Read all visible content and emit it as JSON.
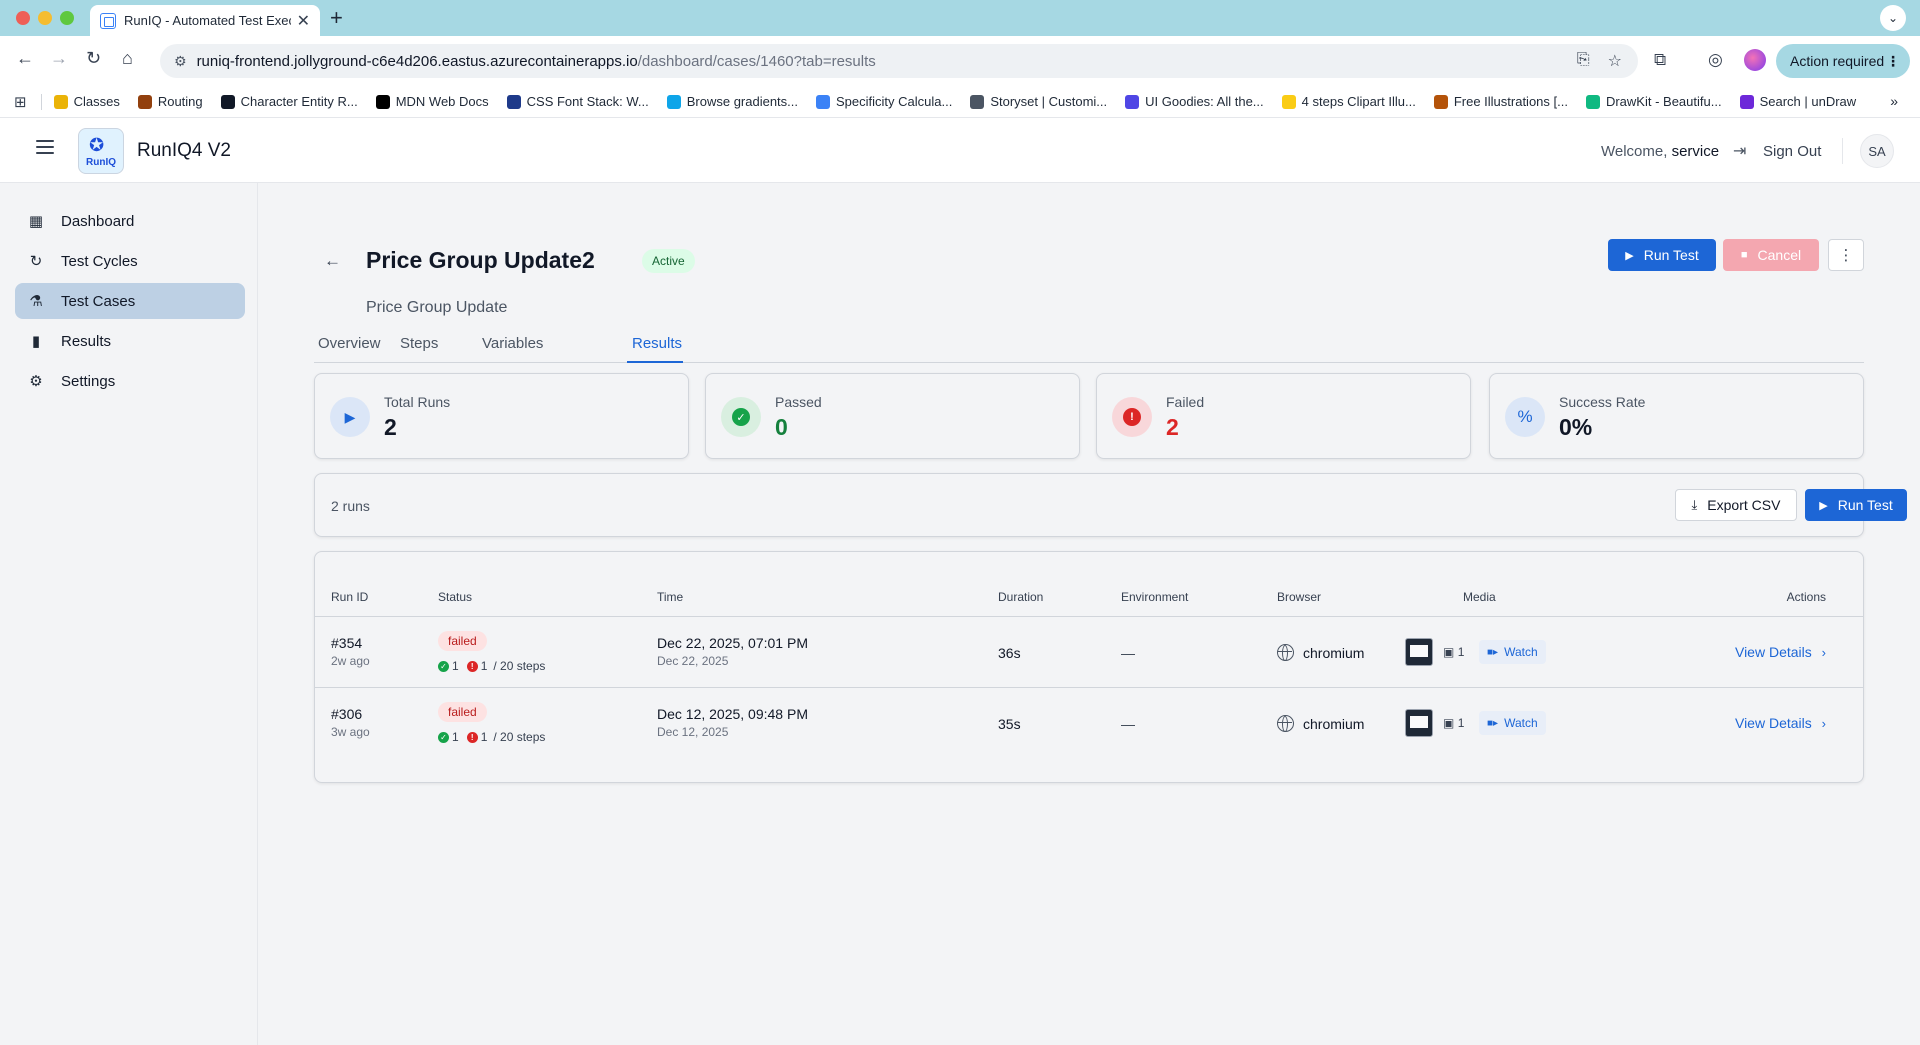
{
  "browser": {
    "tab_title": "RunIQ - Automated Test Exec",
    "url_host": "runiq-frontend.jollyground-c6e4d206.eastus.azurecontainerapps.io",
    "url_path": "/dashboard/cases/1460?tab=results",
    "action_required": "Action required",
    "bookmarks": [
      {
        "label": "Classes",
        "color": "#eab308"
      },
      {
        "label": "Routing",
        "color": "#92400e"
      },
      {
        "label": "Character Entity R...",
        "color": "#111827"
      },
      {
        "label": "MDN Web Docs",
        "color": "#000000"
      },
      {
        "label": "CSS Font Stack: W...",
        "color": "#1e3a8a"
      },
      {
        "label": "Browse gradients...",
        "color": "#0ea5e9"
      },
      {
        "label": "Specificity Calcula...",
        "color": "#3b82f6"
      },
      {
        "label": "Storyset | Customi...",
        "color": "#4b5563"
      },
      {
        "label": "UI Goodies: All the...",
        "color": "#4f46e5"
      },
      {
        "label": "4 steps Clipart Illu...",
        "color": "#facc15"
      },
      {
        "label": "Free Illustrations [...",
        "color": "#b45309"
      },
      {
        "label": "DrawKit - Beautifu...",
        "color": "#10b981"
      },
      {
        "label": "Search | unDraw",
        "color": "#6d28d9"
      }
    ]
  },
  "app": {
    "title": "RunIQ4 V2",
    "welcome_prefix": "Welcome,",
    "username": "service",
    "sign_out": "Sign Out",
    "avatar_initials": "SA",
    "logo_text": "RunIQ"
  },
  "sidebar": {
    "items": [
      {
        "label": "Dashboard",
        "icon": "dashboard-icon"
      },
      {
        "label": "Test Cycles",
        "icon": "refresh-icon"
      },
      {
        "label": "Test Cases",
        "icon": "flask-icon",
        "active": true
      },
      {
        "label": "Results",
        "icon": "bar-chart-icon"
      },
      {
        "label": "Settings",
        "icon": "gear-icon"
      }
    ]
  },
  "page": {
    "title": "Price Group Update2",
    "status": "Active",
    "subtitle": "Price Group Update",
    "run_test": "Run Test",
    "cancel": "Cancel",
    "tabs": [
      "Overview",
      "Steps",
      "Variables",
      "Results"
    ],
    "active_tab": "Results"
  },
  "stats": [
    {
      "label": "Total Runs",
      "value": "2",
      "color": "#111827",
      "bg": "#dbe6f7",
      "icon_color": "#1d66d6"
    },
    {
      "label": "Passed",
      "value": "0",
      "color": "#15803d",
      "bg": "#d9efe0",
      "icon_color": "#16a34a"
    },
    {
      "label": "Failed",
      "value": "2",
      "color": "#dc2626",
      "bg": "#f8d7da",
      "icon_color": "#dc2626"
    },
    {
      "label": "Success Rate",
      "value": "0%",
      "color": "#111827",
      "bg": "#dbe6f7",
      "icon_color": "#1d66d6"
    }
  ],
  "runs_bar": {
    "count_label": "2 runs",
    "export": "Export CSV",
    "run_test": "Run Test"
  },
  "table": {
    "headers": [
      "Run ID",
      "Status",
      "Time",
      "Duration",
      "Environment",
      "Browser",
      "Media",
      "Actions"
    ],
    "rows": [
      {
        "id": "#354",
        "ago": "2w ago",
        "status": "failed",
        "passed": "1",
        "failed": "1",
        "steps": "/ 20 steps",
        "time": "Dec 22, 2025, 07:01 PM",
        "date": "Dec 22, 2025",
        "duration": "36s",
        "environment": "—",
        "browser": "chromium",
        "images": "1",
        "watch": "Watch",
        "details": "View Details"
      },
      {
        "id": "#306",
        "ago": "3w ago",
        "status": "failed",
        "passed": "1",
        "failed": "1",
        "steps": "/ 20 steps",
        "time": "Dec 12, 2025, 09:48 PM",
        "date": "Dec 12, 2025",
        "duration": "35s",
        "environment": "—",
        "browser": "chromium",
        "images": "1",
        "watch": "Watch",
        "details": "View Details"
      }
    ]
  }
}
